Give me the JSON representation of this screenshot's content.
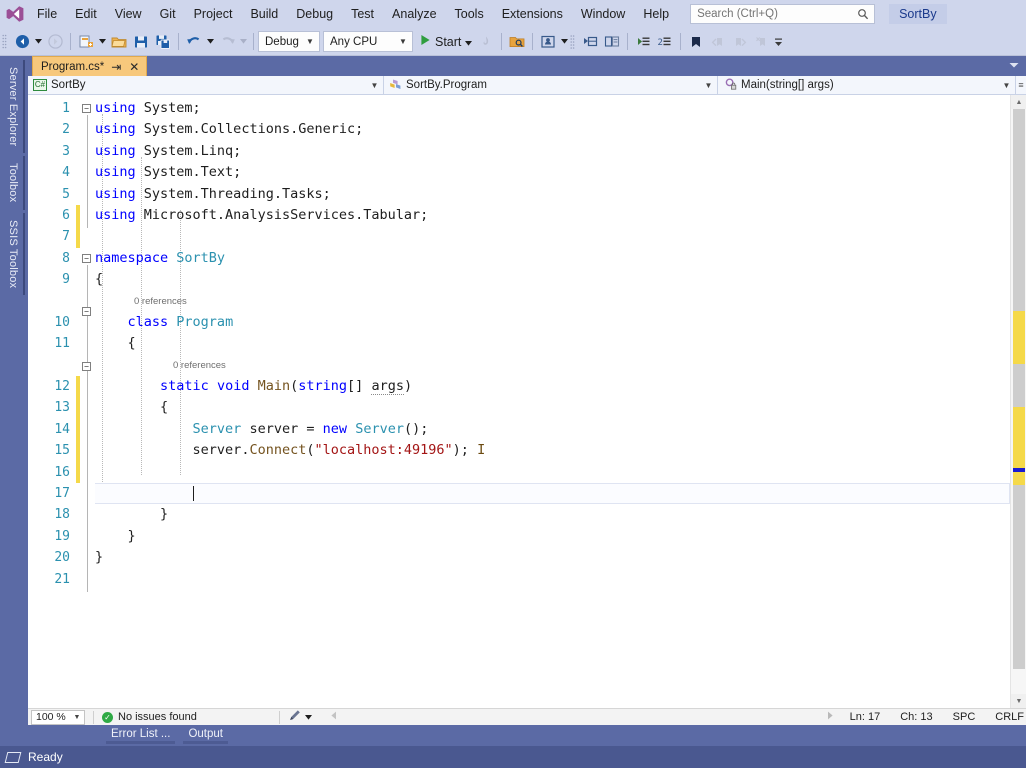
{
  "window": {
    "solution_name": "SortBy",
    "brand_accent": "#5b6aa5",
    "tab_accent": "#f7c87c"
  },
  "menubar": {
    "logo_icon": "visual-studio-logo",
    "items": [
      {
        "label": "File"
      },
      {
        "label": "Edit"
      },
      {
        "label": "View"
      },
      {
        "label": "Git"
      },
      {
        "label": "Project"
      },
      {
        "label": "Build"
      },
      {
        "label": "Debug"
      },
      {
        "label": "Test"
      },
      {
        "label": "Analyze"
      },
      {
        "label": "Tools"
      },
      {
        "label": "Extensions"
      },
      {
        "label": "Window"
      },
      {
        "label": "Help"
      }
    ],
    "search": {
      "placeholder": "Search (Ctrl+Q)",
      "value": "",
      "icon": "search-icon"
    }
  },
  "toolbar": {
    "grip_icon": "drag-grip-icon",
    "nav_back_icon": "navigate-back-icon",
    "nav_forward_icon": "navigate-forward-icon",
    "new_item_icon": "new-item-icon",
    "open_file_icon": "open-file-icon",
    "save_icon": "save-icon",
    "save_all_icon": "save-all-icon",
    "undo_icon": "undo-icon",
    "redo_icon": "redo-icon",
    "config_label": "Debug",
    "platform_label": "Any CPU",
    "start_label": "Start",
    "start_icon": "play-icon",
    "hot_reload_icon": "hot-reload-icon",
    "preview_icon": "preview-changes-icon",
    "live_share_icon": "live-share-icon",
    "overflow_icon": "toolbar-overflow-icon",
    "step_icon_a": "step-into-icon",
    "step_icon_b": "step-over-icon",
    "indent_icon_a": "increase-indent-icon",
    "indent_icon_b": "comment-selection-icon",
    "bookmark_icon": "bookmark-icon",
    "bookmark_prev_icon": "previous-bookmark-icon",
    "bookmark_next_icon": "next-bookmark-icon",
    "bookmark_clear_icon": "clear-bookmarks-icon"
  },
  "leftdock": {
    "tabs": [
      {
        "label": "Server Explorer"
      },
      {
        "label": "Toolbox"
      },
      {
        "label": "SSIS Toolbox"
      }
    ]
  },
  "document_tabs": {
    "active": {
      "title": "Program.cs*",
      "pin_icon": "pin-icon",
      "close_icon": "close-icon"
    },
    "overflow_icon": "tab-overflow-icon"
  },
  "navbar": {
    "project": {
      "label": "SortBy",
      "badge": "C#",
      "icon": "csharp-file-icon"
    },
    "type": {
      "label": "SortBy.Program",
      "icon": "class-icon"
    },
    "member": {
      "label": "Main(string[] args)",
      "icon": "method-private-icon"
    },
    "arrow_icon": "chevron-down-icon"
  },
  "editor": {
    "line_numbers": [
      "1",
      "2",
      "3",
      "4",
      "5",
      "6",
      "7",
      "8",
      "9",
      "10",
      "11",
      "12",
      "13",
      "14",
      "15",
      "16",
      "17",
      "18",
      "19",
      "20",
      "21"
    ],
    "current_line": 17,
    "code_lens": [
      {
        "after_line": 9,
        "label": "0 references"
      },
      {
        "after_line": 11,
        "label": "0 references"
      }
    ],
    "lines": [
      {
        "n": 1,
        "text": "using System;"
      },
      {
        "n": 2,
        "text": "using System.Collections.Generic;"
      },
      {
        "n": 3,
        "text": "using System.Linq;"
      },
      {
        "n": 4,
        "text": "using System.Text;"
      },
      {
        "n": 5,
        "text": "using System.Threading.Tasks;"
      },
      {
        "n": 6,
        "text": "using Microsoft.AnalysisServices.Tabular;"
      },
      {
        "n": 7,
        "text": ""
      },
      {
        "n": 8,
        "text": "namespace SortBy"
      },
      {
        "n": 9,
        "text": "{"
      },
      {
        "n": 10,
        "text": "    class Program"
      },
      {
        "n": 11,
        "text": "    {"
      },
      {
        "n": 12,
        "text": "        static void Main(string[] args)"
      },
      {
        "n": 13,
        "text": "        {"
      },
      {
        "n": 14,
        "text": "            Server server = new Server();"
      },
      {
        "n": 15,
        "text": "            server.Connect(\"localhost:49196\");"
      },
      {
        "n": 16,
        "text": ""
      },
      {
        "n": 17,
        "text": ""
      },
      {
        "n": 18,
        "text": "        }"
      },
      {
        "n": 19,
        "text": "    }"
      },
      {
        "n": 20,
        "text": "}"
      },
      {
        "n": 21,
        "text": ""
      }
    ],
    "changed_lines": [
      6,
      7,
      13,
      14,
      15,
      16,
      17
    ],
    "colors": {
      "keyword": "#0000ff",
      "type": "#2b91af",
      "string": "#a31515",
      "method": "#74531f",
      "line_number": "#2b91af",
      "change_bar": "#f5d949"
    },
    "scrollbar": {
      "up_icon": "scroll-up-icon",
      "down_icon": "scroll-down-icon",
      "caret_marker_color": "#1b1bd0",
      "change_marker_color": "#f5d949"
    }
  },
  "editor_status": {
    "zoom": "100 %",
    "zoom_arrow_icon": "chevron-down-icon",
    "issues_label": "No issues found",
    "issues_icon": "check-circle-icon",
    "pen_icon": "pen-icon",
    "pen_arrow_icon": "chevron-down-icon",
    "hscroll_left_icon": "scroll-left-icon",
    "hscroll_right_icon": "scroll-right-icon",
    "line": "Ln: 17",
    "column": "Ch: 13",
    "spaces": "SPC",
    "line_ending": "CRLF"
  },
  "bottom_panel": {
    "tabs": [
      {
        "label": "Error List ..."
      },
      {
        "label": "Output"
      }
    ]
  },
  "statusbar": {
    "glyph": "ready-glyph-icon",
    "text": "Ready"
  }
}
